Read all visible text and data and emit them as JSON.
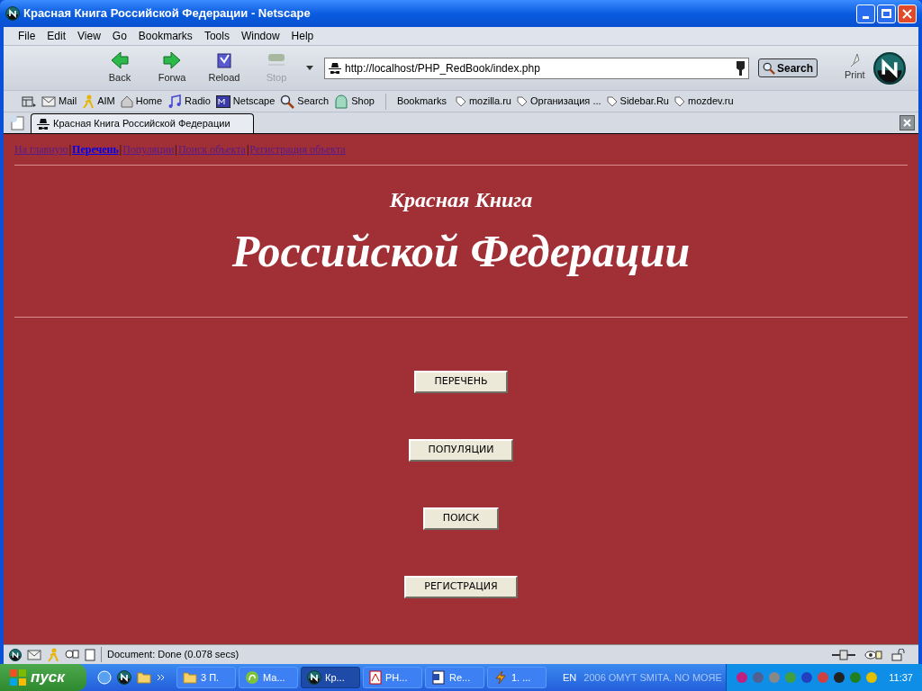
{
  "window": {
    "title": "Красная Книга Российской Федерации - Netscape"
  },
  "menu": [
    "File",
    "Edit",
    "View",
    "Go",
    "Bookmarks",
    "Tools",
    "Window",
    "Help"
  ],
  "nav_buttons": [
    {
      "kind": "back",
      "label": "Back",
      "disabled": false
    },
    {
      "kind": "forward",
      "label": "Forwa",
      "disabled": false
    },
    {
      "kind": "reload",
      "label": "Reload",
      "disabled": false
    },
    {
      "kind": "stop",
      "label": "Stop",
      "disabled": true
    }
  ],
  "address": {
    "value": "http://localhost/PHP_RedBook/index.php"
  },
  "search_button": "Search",
  "print_button": "Print",
  "personal_toolbar": [
    {
      "kind": "mail",
      "label": "Mail"
    },
    {
      "kind": "aim",
      "label": "AIM"
    },
    {
      "kind": "home",
      "label": "Home"
    },
    {
      "kind": "radio",
      "label": "Radio"
    },
    {
      "kind": "netscape",
      "label": "Netscape"
    },
    {
      "kind": "search",
      "label": "Search"
    },
    {
      "kind": "shop",
      "label": "Shop"
    }
  ],
  "bookmarks_label": "Bookmarks",
  "bookmarks": [
    "mozilla.ru",
    "Организация ...",
    "Sidebar.Ru",
    "mozdev.ru"
  ],
  "tab": {
    "title": "Красная Книга Российской Федерации"
  },
  "page": {
    "nav_separator": "|",
    "nav_links": [
      {
        "label": "На главную",
        "selected": false
      },
      {
        "label": "Перечень",
        "selected": true
      },
      {
        "label": "Популяции",
        "selected": false
      },
      {
        "label": "Поиск объекта",
        "selected": false
      },
      {
        "label": "Регистрация объекта",
        "selected": false
      }
    ],
    "subtitle": "Красная Книга",
    "title": "Российской Федерации",
    "buttons": [
      "ПЕРЕЧЕНЬ",
      "ПОПУЛЯЦИИ",
      "ПОИСК",
      "РЕГИСТРАЦИЯ"
    ]
  },
  "status_bar": {
    "text": "Document: Done (0.078 secs)"
  },
  "taskbar": {
    "start": "пуск",
    "tasks": [
      {
        "kind": "folder",
        "label": "3 П.",
        "selected": false
      },
      {
        "kind": "app",
        "label": "Ма...",
        "selected": false
      },
      {
        "kind": "netscape",
        "label": "Кр...",
        "selected": true
      },
      {
        "kind": "pdf",
        "label": "PH...",
        "selected": false
      },
      {
        "kind": "word",
        "label": "Re...",
        "selected": false
      },
      {
        "kind": "winamp",
        "label": "1. ...",
        "selected": false
      }
    ],
    "language": "EN",
    "ticker": "2006 OMYT SMITA. NO MOЯE",
    "clock": "11:37"
  }
}
